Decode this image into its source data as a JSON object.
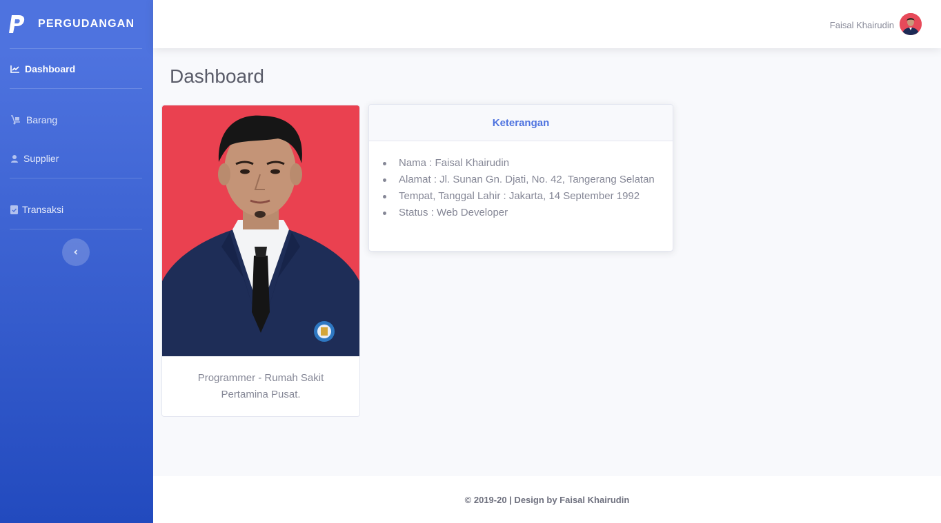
{
  "brand": {
    "name": "PERGUDANGAN",
    "logo_icon": "paypal-p-icon"
  },
  "sidebar": {
    "items": [
      {
        "label": "Dashboard",
        "icon": "chart-line-icon",
        "active": true
      },
      {
        "label": "Barang",
        "icon": "dolly-icon",
        "active": false
      },
      {
        "label": "Supplier",
        "icon": "user-icon",
        "active": false
      },
      {
        "label": "Transaksi",
        "icon": "clipboard-check-icon",
        "active": false
      }
    ],
    "toggle_icon": "chevron-left-icon"
  },
  "topbar": {
    "user_name": "Faisal Khairudin"
  },
  "main": {
    "page_title": "Dashboard",
    "profile_card": {
      "caption": "Programmer - Rumah Sakit Pertamina Pusat."
    },
    "info_card": {
      "title": "Keterangan",
      "items": [
        "Nama : Faisal Khairudin",
        "Alamat : Jl. Sunan Gn. Djati, No. 42, Tangerang Selatan",
        "Tempat, Tanggal Lahir : Jakarta, 14 September 1992",
        "Status : Web Developer"
      ]
    }
  },
  "footer": {
    "text": "© 2019-20 | Design by Faisal Khairudin"
  },
  "colors": {
    "primary": "#4e73df",
    "sidebar_end": "#224abe",
    "text_muted": "#858796",
    "photo_bg": "#ea4150"
  }
}
